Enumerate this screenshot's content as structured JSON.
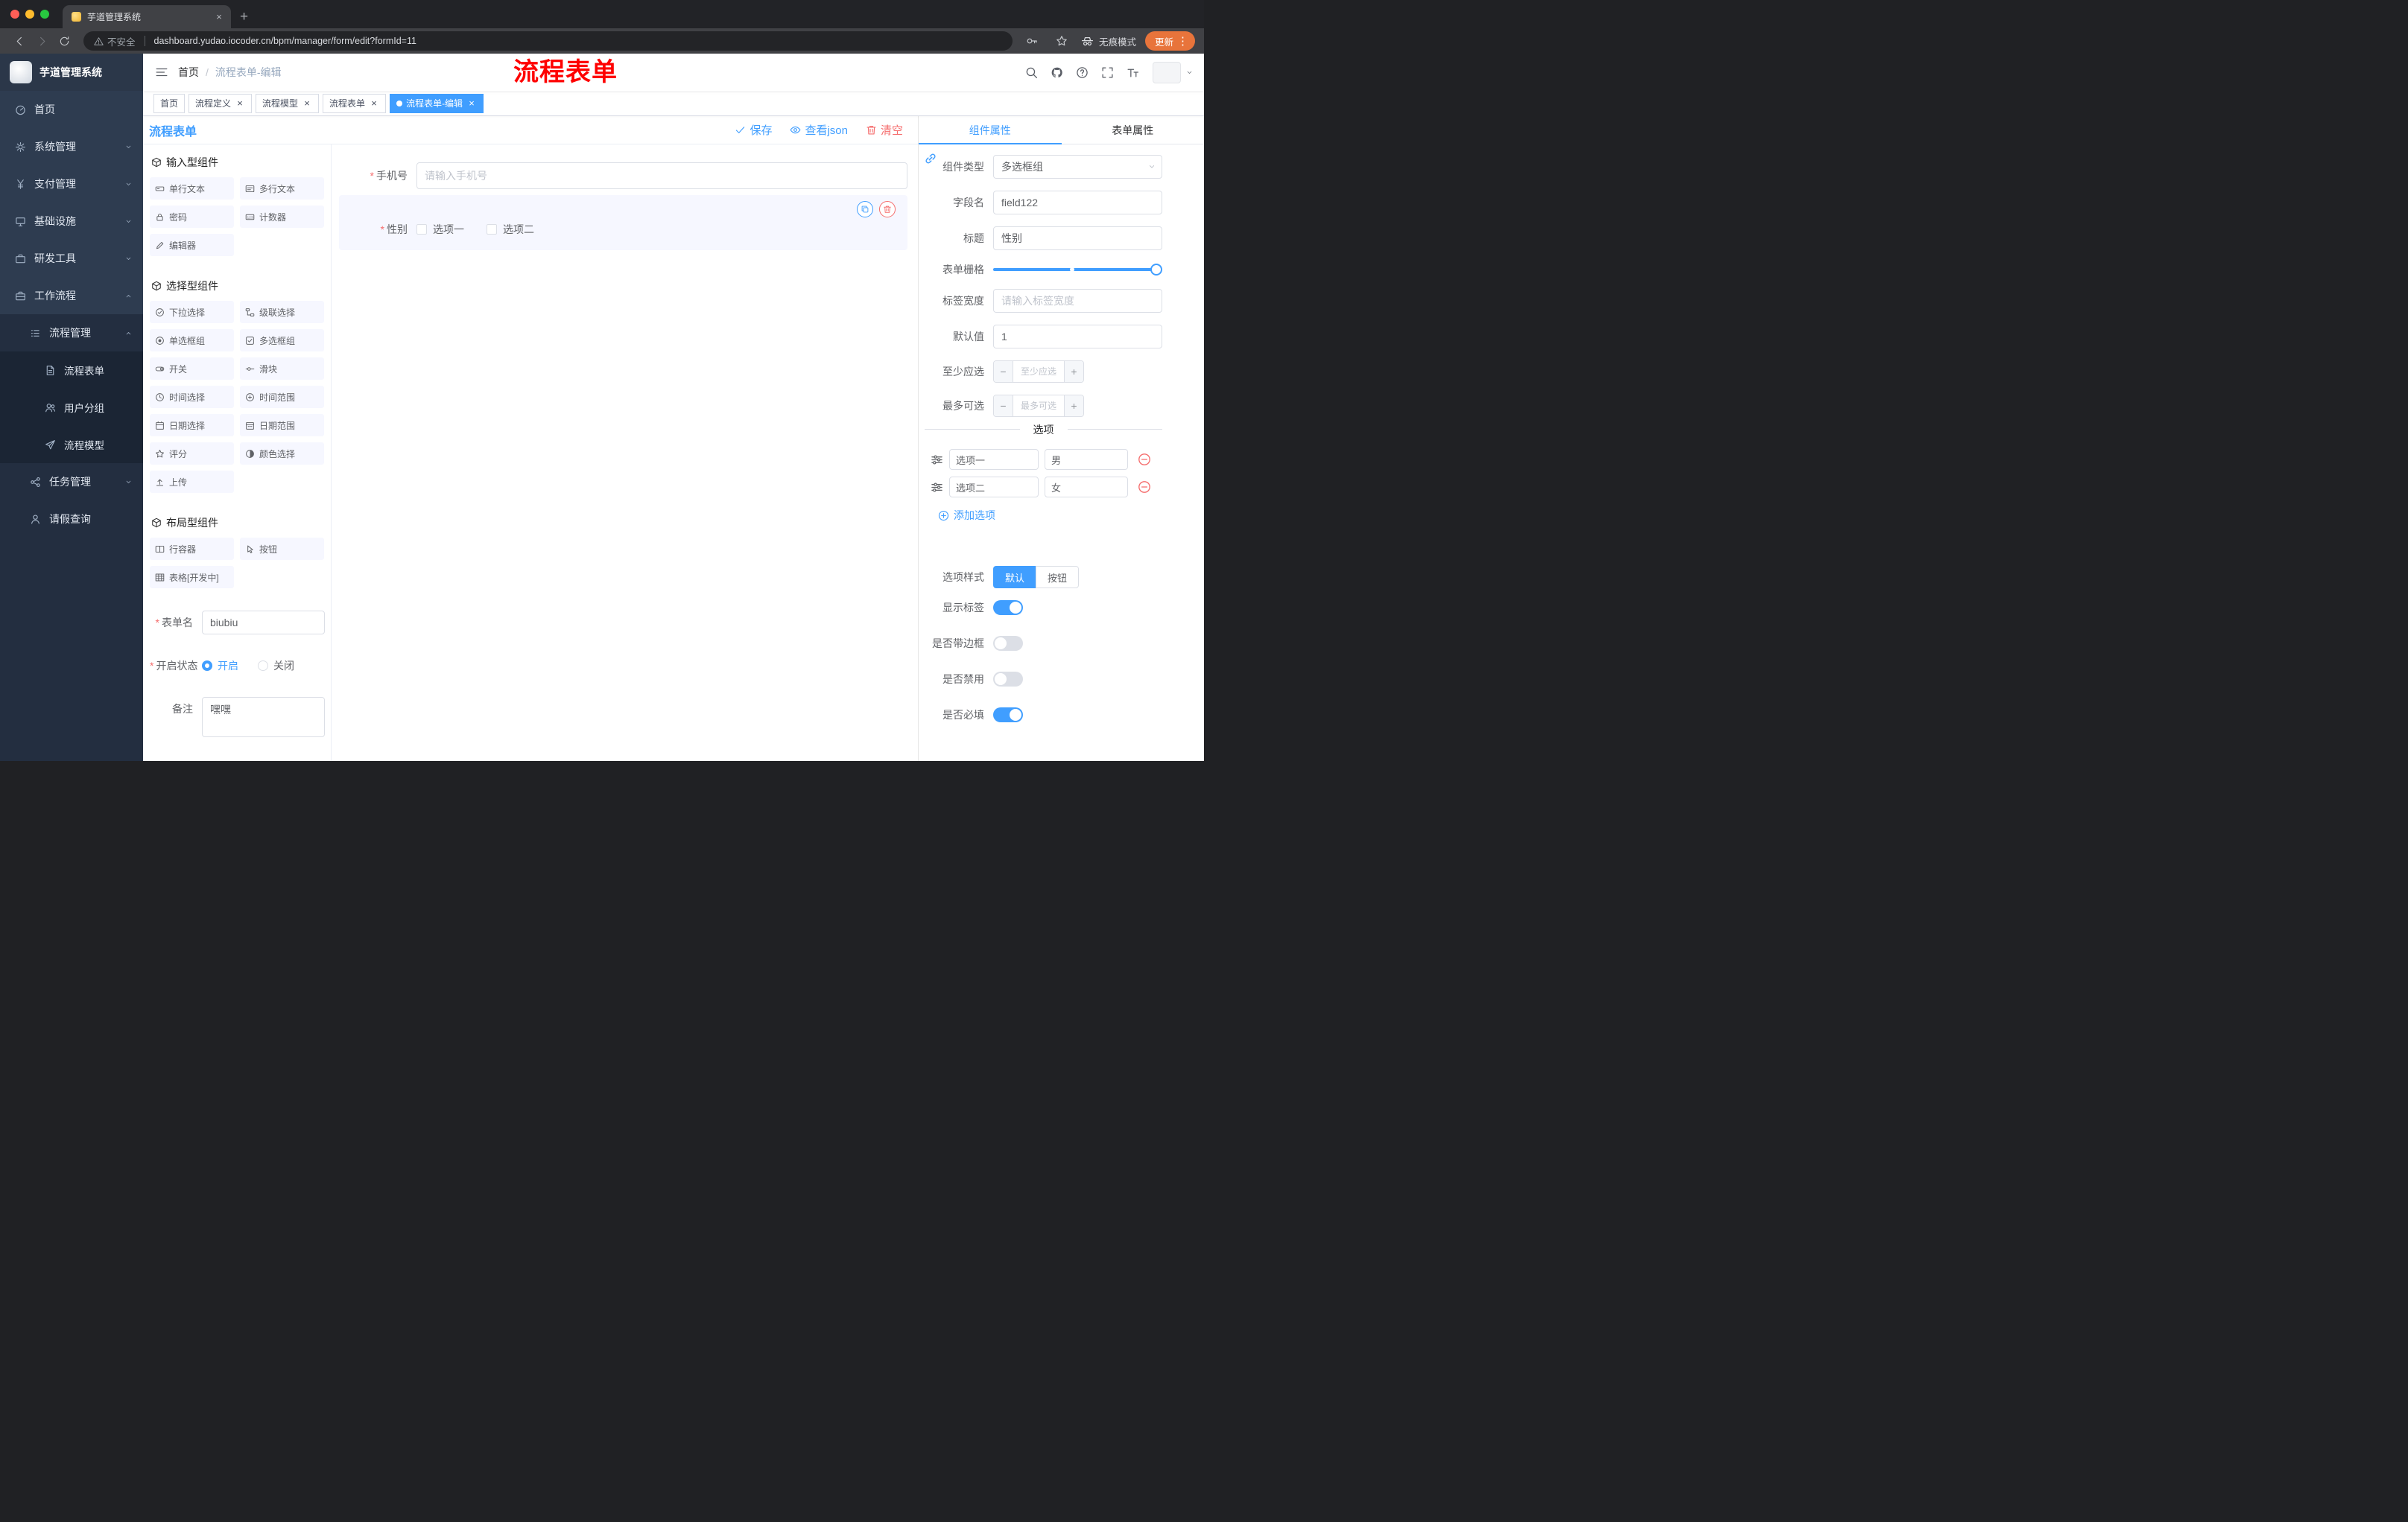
{
  "colors": {
    "accent": "#409eff",
    "danger": "#f56c6c",
    "annotation": "#fe0000",
    "update_button": "#e8743b"
  },
  "browser": {
    "tab_title": "芋道管理系统",
    "security_label": "不安全",
    "url": "dashboard.yudao.iocoder.cn/bpm/manager/form/edit?formId=11",
    "incognito_label": "无痕模式",
    "update_label": "更新"
  },
  "sidebar": {
    "logo_title": "芋道管理系统",
    "items": [
      {
        "label": "首页"
      },
      {
        "label": "系统管理"
      },
      {
        "label": "支付管理"
      },
      {
        "label": "基础设施"
      },
      {
        "label": "研发工具"
      },
      {
        "label": "工作流程"
      },
      {
        "label": "流程管理"
      },
      {
        "label": "流程表单"
      },
      {
        "label": "用户分组"
      },
      {
        "label": "流程模型"
      },
      {
        "label": "任务管理"
      },
      {
        "label": "请假查询"
      }
    ]
  },
  "navbar": {
    "breadcrumb": {
      "home": "首页",
      "separator": "/",
      "current": "流程表单-编辑"
    },
    "annotation": "流程表单"
  },
  "tags": [
    {
      "label": "首页"
    },
    {
      "label": "流程定义"
    },
    {
      "label": "流程模型"
    },
    {
      "label": "流程表单"
    },
    {
      "label": "流程表单-编辑"
    }
  ],
  "designer": {
    "title": "流程表单",
    "actions": {
      "save": "保存",
      "view_json": "查看json",
      "clear": "清空"
    },
    "palette": [
      {
        "title": "输入型组件",
        "items": [
          "单行文本",
          "多行文本",
          "密码",
          "计数器",
          "编辑器"
        ]
      },
      {
        "title": "选择型组件",
        "items": [
          "下拉选择",
          "级联选择",
          "单选框组",
          "多选框组",
          "开关",
          "滑块",
          "时间选择",
          "时间范围",
          "日期选择",
          "日期范围",
          "评分",
          "颜色选择",
          "上传"
        ]
      },
      {
        "title": "布局型组件",
        "items": [
          "行容器",
          "按钮",
          "表格[开发中]"
        ]
      }
    ],
    "meta": {
      "form_name_label": "表单名",
      "form_name_value": "biubiu",
      "status_label": "开启状态",
      "status_on": "开启",
      "status_off": "关闭",
      "remark_label": "备注",
      "remark_value": "嘿嘿"
    },
    "canvas": {
      "phone_label": "手机号",
      "phone_placeholder": "请输入手机号",
      "gender_label": "性别",
      "gender_options": [
        "选项一",
        "选项二"
      ]
    }
  },
  "panel": {
    "tabs": [
      "组件属性",
      "表单属性"
    ],
    "component_type_label": "组件类型",
    "component_type_value": "多选框组",
    "field_name_label": "字段名",
    "field_name_value": "field122",
    "title_label": "标题",
    "title_value": "性别",
    "grid_label": "表单栅格",
    "label_width_label": "标签宽度",
    "label_width_placeholder": "请输入标签宽度",
    "default_label": "默认值",
    "default_value": "1",
    "min_label": "至少应选",
    "min_placeholder": "至少应选",
    "max_label": "最多可选",
    "max_placeholder": "最多可选",
    "options_divider": "选项",
    "options": [
      {
        "label": "选项一",
        "value": "男"
      },
      {
        "label": "选项二",
        "value": "女"
      }
    ],
    "add_option": "添加选项",
    "style_label": "选项样式",
    "style_default": "默认",
    "style_button": "按钮",
    "switch_show_label": "显示标签",
    "switch_border": "是否带边框",
    "switch_disabled": "是否禁用",
    "switch_required": "是否必填"
  }
}
